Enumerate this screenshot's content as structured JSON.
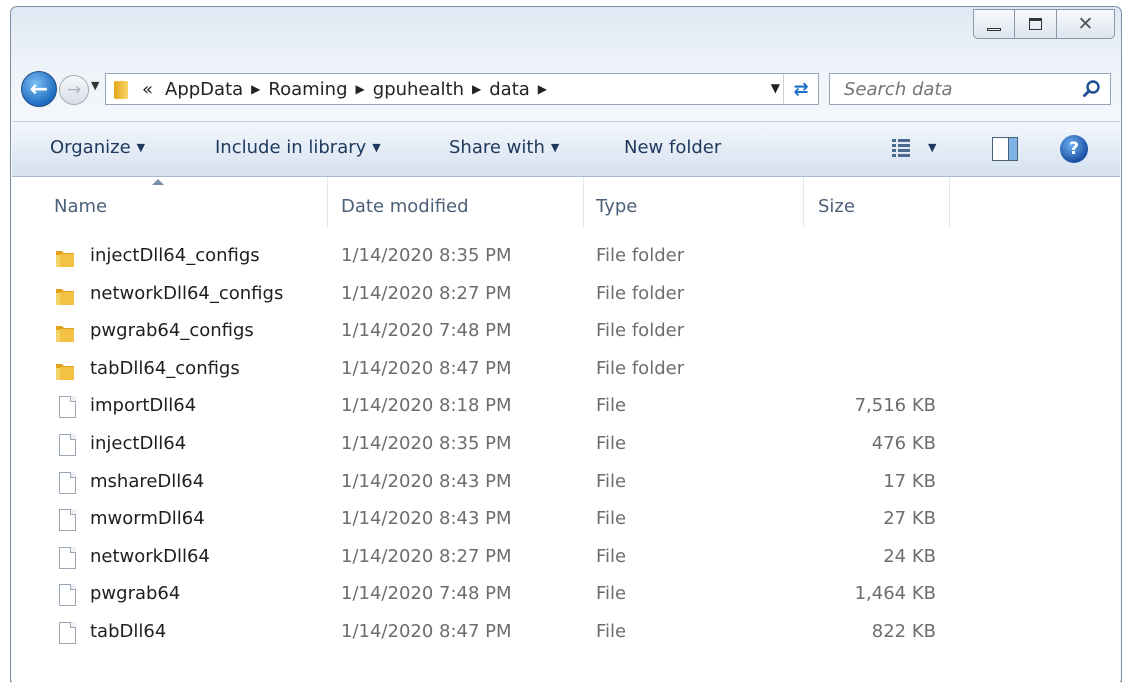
{
  "window": {
    "controls": {
      "minimize": "minimize",
      "maximize": "maximize",
      "close": "✕"
    }
  },
  "nav": {
    "back_icon": "back-arrow-icon",
    "forward_icon": "forward-arrow-icon"
  },
  "address": {
    "prefix": "«",
    "crumbs": [
      "AppData",
      "Roaming",
      "gpuhealth",
      "data"
    ]
  },
  "search": {
    "placeholder": "Search data"
  },
  "toolbar": {
    "organize": "Organize",
    "include_in_library": "Include in library",
    "share_with": "Share with",
    "new_folder": "New folder"
  },
  "columns": {
    "name": "Name",
    "date_modified": "Date modified",
    "type": "Type",
    "size": "Size"
  },
  "files": [
    {
      "name": "injectDll64_configs",
      "date": "1/14/2020 8:35 PM",
      "type": "File folder",
      "size": "",
      "icon": "folder"
    },
    {
      "name": "networkDll64_configs",
      "date": "1/14/2020 8:27 PM",
      "type": "File folder",
      "size": "",
      "icon": "folder"
    },
    {
      "name": "pwgrab64_configs",
      "date": "1/14/2020 7:48 PM",
      "type": "File folder",
      "size": "",
      "icon": "folder"
    },
    {
      "name": "tabDll64_configs",
      "date": "1/14/2020 8:47 PM",
      "type": "File folder",
      "size": "",
      "icon": "folder"
    },
    {
      "name": "importDll64",
      "date": "1/14/2020 8:18 PM",
      "type": "File",
      "size": "7,516 KB",
      "icon": "file"
    },
    {
      "name": "injectDll64",
      "date": "1/14/2020 8:35 PM",
      "type": "File",
      "size": "476 KB",
      "icon": "file"
    },
    {
      "name": "mshareDll64",
      "date": "1/14/2020 8:43 PM",
      "type": "File",
      "size": "17 KB",
      "icon": "file"
    },
    {
      "name": "mwormDll64",
      "date": "1/14/2020 8:43 PM",
      "type": "File",
      "size": "27 KB",
      "icon": "file"
    },
    {
      "name": "networkDll64",
      "date": "1/14/2020 8:27 PM",
      "type": "File",
      "size": "24 KB",
      "icon": "file"
    },
    {
      "name": "pwgrab64",
      "date": "1/14/2020 7:48 PM",
      "type": "File",
      "size": "1,464 KB",
      "icon": "file"
    },
    {
      "name": "tabDll64",
      "date": "1/14/2020 8:47 PM",
      "type": "File",
      "size": "822 KB",
      "icon": "file"
    }
  ]
}
